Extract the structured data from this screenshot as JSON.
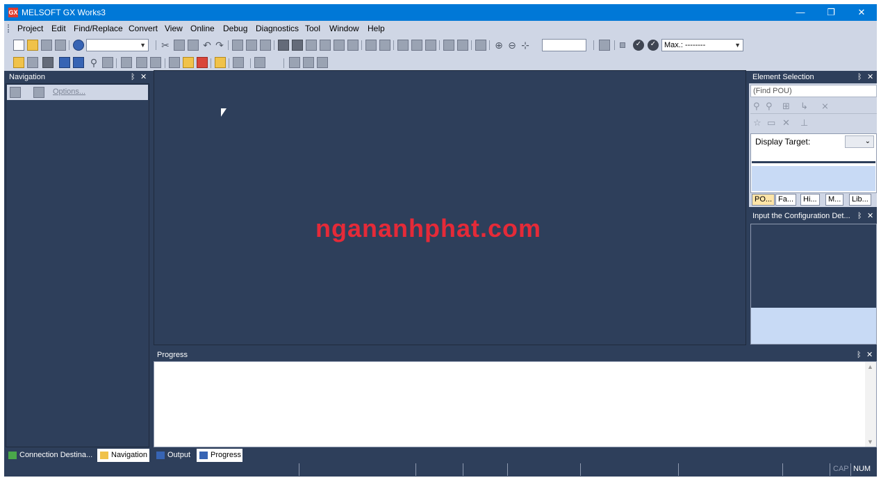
{
  "window": {
    "title": "MELSOFT GX Works3",
    "app_icon": "GX"
  },
  "titlebar_controls": {
    "minimize": "—",
    "restore": "❐",
    "close": "✕"
  },
  "menu": [
    "Project",
    "Edit",
    "Find/Replace",
    "Convert",
    "View",
    "Online",
    "Debug",
    "Diagnostics",
    "Tool",
    "Window",
    "Help"
  ],
  "toolbar": {
    "max_label": "Max.: --------",
    "zoom_value": ""
  },
  "navigation": {
    "title": "Navigation",
    "options_label": "Options..."
  },
  "element_selection": {
    "title": "Element Selection",
    "find_placeholder": "(Find POU)",
    "display_target_label": "Display Target:",
    "tabs": [
      "PO...",
      "Fa...",
      "Hi...",
      "M...",
      "Lib..."
    ]
  },
  "input_config": {
    "title": "Input the Configuration Det..."
  },
  "progress": {
    "title": "Progress"
  },
  "editor": {
    "watermark": "ngananhphat.com"
  },
  "dock_tabs": {
    "left": [
      "Connection Destina...",
      "Navigation"
    ],
    "bottom": [
      "Output",
      "Progress"
    ]
  },
  "status": {
    "cap": "CAP",
    "num": "NUM"
  },
  "pin_close": {
    "pin": "ᛒ",
    "close": "✕"
  }
}
